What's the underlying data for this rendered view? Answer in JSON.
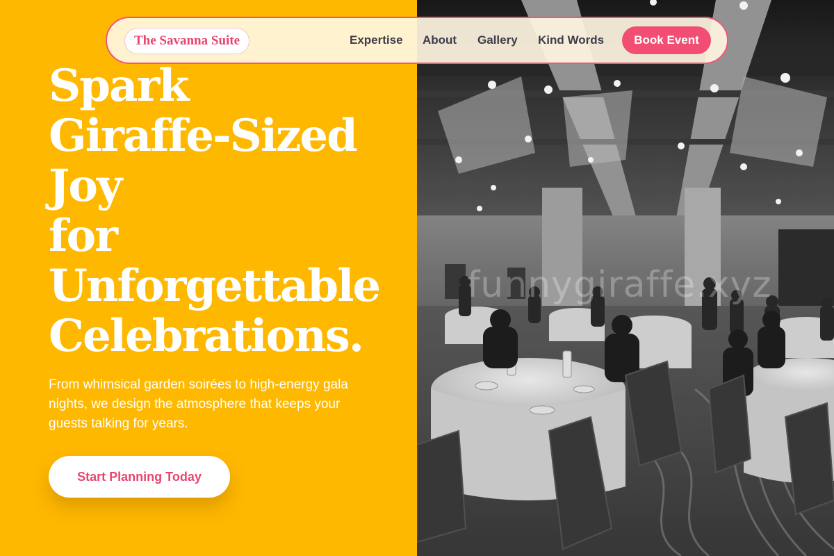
{
  "brand": {
    "name": "The Savanna Suite"
  },
  "nav": {
    "links": [
      "Expertise",
      "About",
      "Gallery",
      "Kind Words"
    ],
    "book_label": "Book Event"
  },
  "hero": {
    "title_lines": [
      "Spark",
      "Giraffe-Sized",
      "Joy",
      "for",
      "Unforgettable",
      "Celebrations."
    ],
    "subtitle": "From whimsical garden soirées to high-energy gala nights, we design the atmosphere that keeps your guests talking for years.",
    "cta_label": "Start Planning Today"
  },
  "image": {
    "watermark": "funnygiraffe.xyz",
    "subject": "banquet-hall-photo"
  },
  "colors": {
    "background": "#FFB800",
    "accent": "#F24D72",
    "text_on_yellow": "#FFFFFF",
    "nav_text": "#3D3D4A"
  }
}
